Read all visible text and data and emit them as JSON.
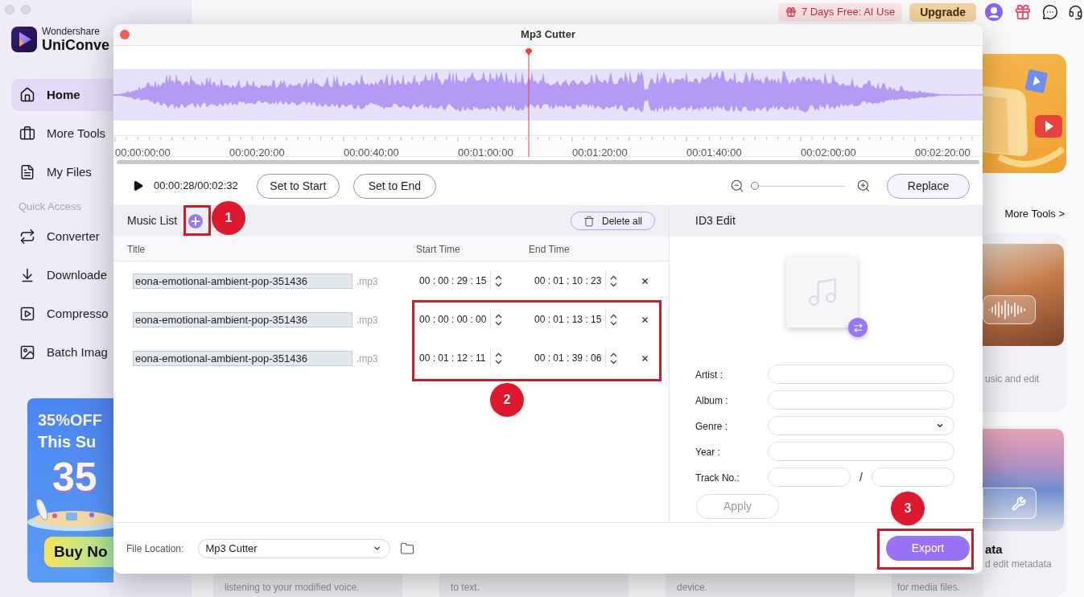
{
  "sidebar": {
    "brand": {
      "company": "Wondershare",
      "product": "UniConve"
    },
    "nav": [
      {
        "label": "Home",
        "selected": true
      },
      {
        "label": "More Tools",
        "selected": false
      },
      {
        "label": "My Files",
        "selected": false
      }
    ],
    "quick_access": {
      "title": "Quick Access",
      "items": [
        {
          "label": "Converter",
          "selected": false
        },
        {
          "label": "Downloade",
          "selected": false
        },
        {
          "label": "Compresso",
          "selected": false
        },
        {
          "label": "Batch Imag",
          "selected": false
        }
      ]
    },
    "promo": {
      "headline": "35%OFF",
      "subline": "This Su",
      "big_number": "35",
      "button": "Buy No"
    }
  },
  "top_bar": {
    "trial_badge": "7 Days Free: AI Use",
    "upgrade_button": "Upgrade"
  },
  "background_content": {
    "more_tools_link": "More Tools >",
    "side_cards": [
      {
        "description": "usic and edit"
      },
      {
        "title": "ata",
        "description": "d edit metadata"
      }
    ],
    "bottom_cards": [
      {
        "description": "listening to your modified voice."
      },
      {
        "description": "to text."
      },
      {
        "description": "device."
      },
      {
        "description": "for media files."
      }
    ]
  },
  "dialog": {
    "title": "Mp3 Cutter",
    "waveform": {
      "playhead": {
        "level": 0.478
      }
    },
    "timeline_labels": [
      "00:00:00:00",
      "00:00:20:00",
      "00:00:40:00",
      "00:01:00:00",
      "00:01:20:00",
      "00:01:40:00",
      "00:02:00:00",
      "00:02:20:00"
    ],
    "player": {
      "time": "00:00:28/00:02:32",
      "set_start_button": "Set to Start",
      "set_end_button": "Set to End",
      "zoom_slider": {
        "level": 0
      },
      "replace_button": "Replace"
    },
    "music_list": {
      "title": "Music List",
      "delete_all_button": "Delete all",
      "columns": [
        "Title",
        "Start Time",
        "End Time"
      ],
      "rows": [
        {
          "name": "eona-emotional-ambient-pop-351436",
          "extension": ".mp3",
          "start_time": "00 : 00 : 29 : 15",
          "end_time": "00 : 01 : 10 : 23"
        },
        {
          "name": "eona-emotional-ambient-pop-351436",
          "extension": ".mp3",
          "start_time": "00 : 00 : 00 : 00",
          "end_time": "00 : 01 : 13 : 15"
        },
        {
          "name": "eona-emotional-ambient-pop-351436",
          "extension": ".mp3",
          "start_time": "00 : 01 : 12 : 11",
          "end_time": "00 : 01 : 39 : 06"
        }
      ]
    },
    "id3_edit": {
      "title": "ID3 Edit",
      "fields": [
        {
          "label": "Artist :",
          "kind": "text"
        },
        {
          "label": "Album :",
          "kind": "text"
        },
        {
          "label": "Genre :",
          "kind": "select"
        },
        {
          "label": "Year :",
          "kind": "text"
        },
        {
          "label": "Track No.:",
          "kind": "pair",
          "separator": "/"
        }
      ],
      "apply_button": {
        "label": "Apply",
        "disabled": true
      }
    },
    "footer": {
      "file_location_label": "File Location:",
      "file_location": "Mp3 Cutter",
      "export_button": "Export"
    }
  },
  "annotations": [
    {
      "number": "1"
    },
    {
      "number": "2"
    },
    {
      "number": "3"
    }
  ]
}
